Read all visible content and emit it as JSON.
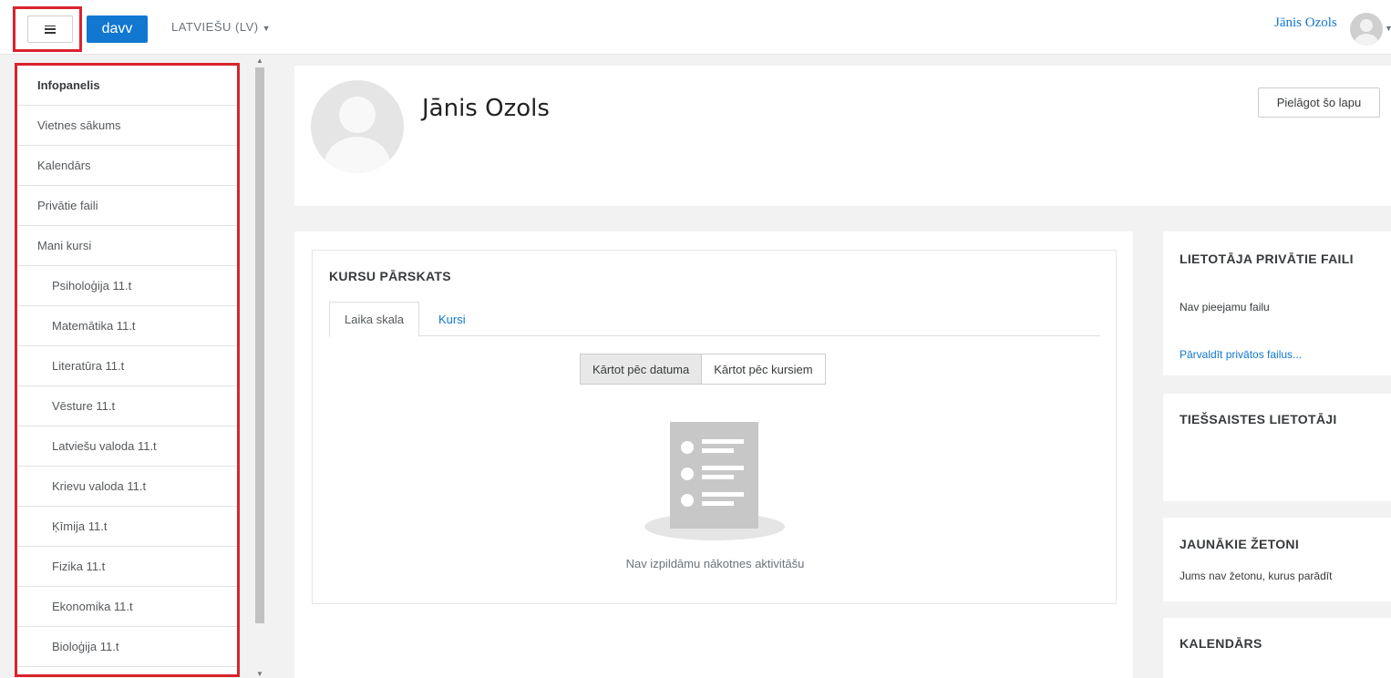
{
  "navbar": {
    "brand": "davv",
    "language": "LATVIEŠU (LV)",
    "user_name": "Jānis Ozols"
  },
  "drawer": {
    "items": [
      {
        "label": "Infopanelis"
      },
      {
        "label": "Vietnes sākums"
      },
      {
        "label": "Kalendārs"
      },
      {
        "label": "Privātie faili"
      },
      {
        "label": "Mani kursi"
      }
    ],
    "courses": [
      {
        "label": "Psiholoģija 11.t"
      },
      {
        "label": "Matemātika 11.t"
      },
      {
        "label": "Literatūra 11.t"
      },
      {
        "label": "Vēsture 11.t"
      },
      {
        "label": "Latviešu valoda 11.t"
      },
      {
        "label": "Krievu valoda 11.t"
      },
      {
        "label": "Ķīmija 11.t"
      },
      {
        "label": "Fizika 11.t"
      },
      {
        "label": "Ekonomika 11.t"
      },
      {
        "label": "Bioloģija 11.t"
      }
    ]
  },
  "header": {
    "title": "Jānis Ozols",
    "customise_button": "Pielāgot šo lapu"
  },
  "overview": {
    "title": "KURSU PĀRSKATS",
    "tabs": [
      {
        "label": "Laika skala"
      },
      {
        "label": "Kursi"
      }
    ],
    "sort_by_date": "Kārtot pēc datuma",
    "sort_by_course": "Kārtot pēc kursiem",
    "empty_message": "Nav izpildāmu nākotnes aktivitāšu"
  },
  "blocks": {
    "private_files": {
      "title": "LIETOTĀJA PRIVĀTIE FAILI",
      "text": "Nav pieejamu failu",
      "link": "Pārvaldīt privātos failus..."
    },
    "online_users": {
      "title": "TIEŠSAISTES LIETOTĀJI"
    },
    "badges": {
      "title": "JAUNĀKIE ŽETONI",
      "text": "Jums nav žetonu, kurus parādīt"
    },
    "calendar": {
      "title": "KALENDĀRS"
    }
  },
  "colors": {
    "brand": "#1177d1",
    "highlight_outline": "#d9232d"
  }
}
